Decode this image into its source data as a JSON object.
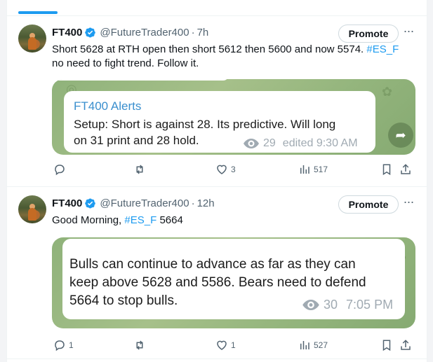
{
  "tweets": [
    {
      "name": "FT400",
      "handle": "@FutureTrader400",
      "time": "7h",
      "promote": "Promote",
      "text_main": "Short 5628 at RTH open then short 5612 then 5600 and now 5574.",
      "text_hashtag": "#ES_F",
      "text_line2": "no need to fight trend. Follow it.",
      "media": {
        "sender": "FT400 Alerts",
        "line1": "Setup: Short is against 28. Its predictive. Will long",
        "line2": "on 31 print and 28 hold.",
        "views": "29",
        "edited": "edited 9:30 AM"
      },
      "stats": {
        "replies": "",
        "reposts": "",
        "likes": "3",
        "views": "517"
      }
    },
    {
      "name": "FT400",
      "handle": "@FutureTrader400",
      "time": "12h",
      "promote": "Promote",
      "text_prefix": "Good Morning,",
      "text_hashtag": "#ES_F",
      "text_suffix": "5664",
      "media": {
        "line1": "Bulls can continue to advance as far as they can",
        "line2": "keep above 5628 and 5586. Bears need to defend",
        "line3": "5664 to stop bulls.",
        "views": "30",
        "time": "7:05 PM"
      },
      "stats": {
        "replies": "1",
        "reposts": "",
        "likes": "1",
        "views": "527"
      }
    }
  ],
  "colors": {
    "accent": "#1d9bf0",
    "text": "#0f1419",
    "muted": "#536471",
    "telegram_bg": "#8fb27a",
    "sender": "#3a8fce"
  },
  "icons": [
    "verified-badge-icon",
    "more-icon",
    "reply-icon",
    "repost-icon",
    "like-icon",
    "views-icon",
    "bookmark-icon",
    "share-icon",
    "eye-icon",
    "forward-icon"
  ]
}
